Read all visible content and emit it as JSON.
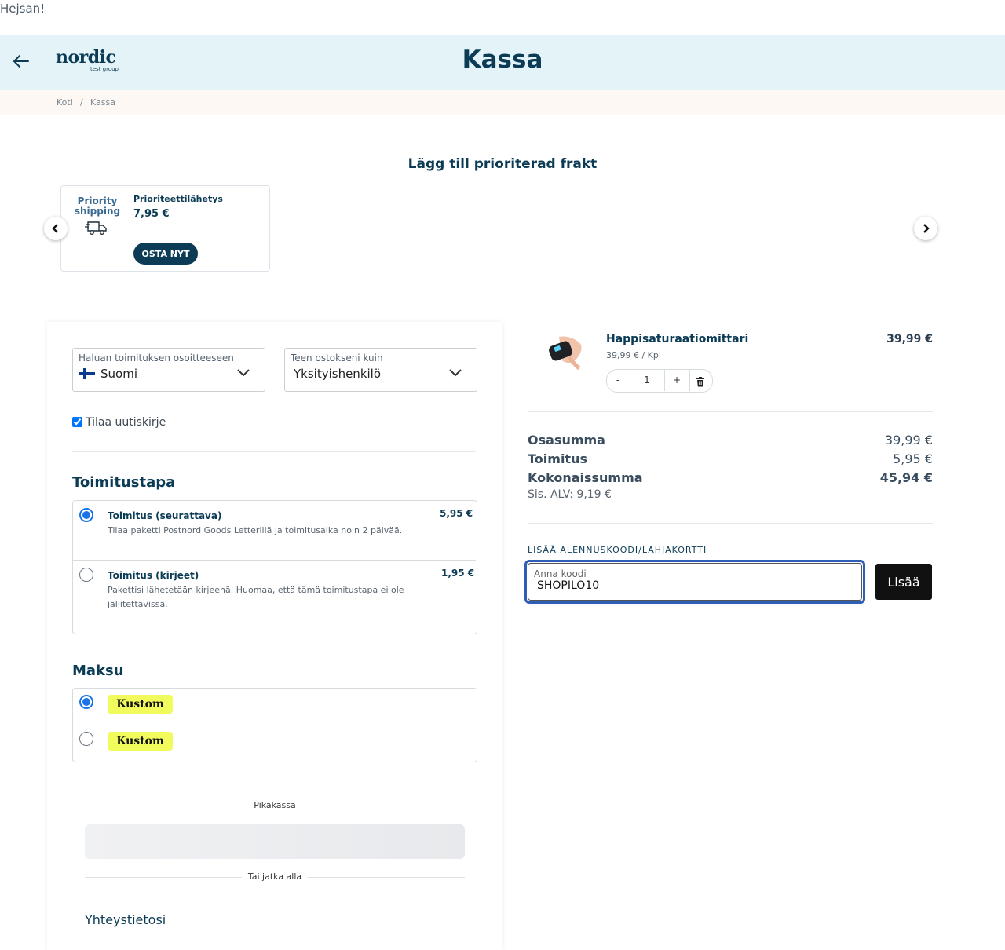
{
  "greeting": "Hejsan!",
  "header": {
    "logo_main": "nordic",
    "logo_sub": "test group",
    "title": "Kassa"
  },
  "breadcrumb": {
    "home": "Koti",
    "sep": "/",
    "current": "Kassa"
  },
  "promo": {
    "section_title": "Lägg till prioriterad frakt",
    "badge_line1": "Priority",
    "badge_line2": "shipping",
    "name": "Prioriteettilähetys",
    "price": "7,95 €",
    "button": "OSTA NYT"
  },
  "form": {
    "country_label": "Haluan toimituksen osoitteeseen",
    "country_value": "Suomi",
    "buyer_label": "Teen ostokseni kuin",
    "buyer_value": "Yksityishenkilö",
    "newsletter_label": "Tilaa uutiskirje",
    "newsletter_checked": true
  },
  "shipping": {
    "title": "Toimitustapa",
    "options": [
      {
        "title": "Toimitus (seurattava)",
        "desc": "Tilaa paketti Postnord Goods Letterillä ja toimitusaika noin 2 päivää.",
        "price": "5,95 €",
        "selected": true
      },
      {
        "title": "Toimitus (kirjeet)",
        "desc_line1": "Pakettisi lähetetään kirjeenä. Huomaa, että tämä toimitustapa ei ole",
        "desc_line2": "jäljitettävissä.",
        "price": "1,95 €",
        "selected": false
      }
    ]
  },
  "payment": {
    "title": "Maksu",
    "options": [
      {
        "label": "Kustom",
        "selected": true
      },
      {
        "label": "Kustom",
        "selected": false
      }
    ]
  },
  "express": {
    "label": "Pikakassa",
    "or_label": "Tai jatka alla"
  },
  "contact_title": "Yhteystietosi",
  "cart": {
    "product_name": "Happisaturaatiomittari",
    "unit_price": "39,99 € / Kpl",
    "price": "39,99 €",
    "quantity": "1",
    "minus": "-",
    "plus": "+"
  },
  "summary": {
    "subtotal_label": "Osasumma",
    "subtotal": "39,99 €",
    "shipping_label": "Toimitus",
    "shipping": "5,95 €",
    "total_label": "Kokonaissumma",
    "total": "45,94 €",
    "vat": "Sis. ALV: 9,19 €"
  },
  "discount": {
    "label": "LISÄÄ ALENNUSKOODI/LAHJAKORTTI",
    "placeholder": "Anna koodi",
    "value": "SHOPILO10",
    "button": "Lisää"
  },
  "colors": {
    "brand": "#0b3b55",
    "header_bg": "#e4f3f8",
    "focus": "#2f5eb5",
    "kustom": "#f2fb5c"
  }
}
